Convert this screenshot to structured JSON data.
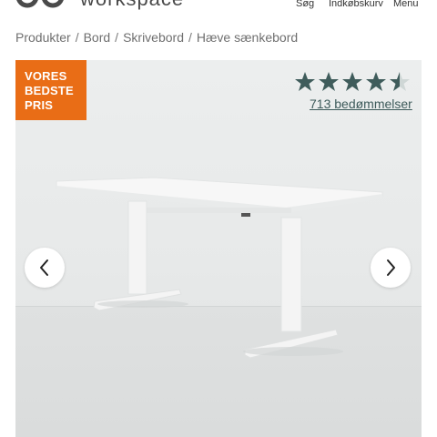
{
  "header": {
    "logo_text": "workspace",
    "search_label": "Søg",
    "cart_label": "Indkøbskurv",
    "menu_label": "Menu"
  },
  "breadcrumb": {
    "items": [
      "Produkter",
      "Bord",
      "Skrivebord",
      "Hæve sænkebord"
    ],
    "separator": "/"
  },
  "gallery": {
    "badge_lines": [
      "VORES",
      "BEDSTE",
      "PRIS"
    ],
    "badge_color": "#e96d16",
    "rating_value": 4.5,
    "rating_max": 5,
    "star_color": "#3f5c5b",
    "reviews_text": "713 bedømmelser",
    "prev_icon": "chevron-left-icon",
    "next_icon": "chevron-right-icon"
  }
}
